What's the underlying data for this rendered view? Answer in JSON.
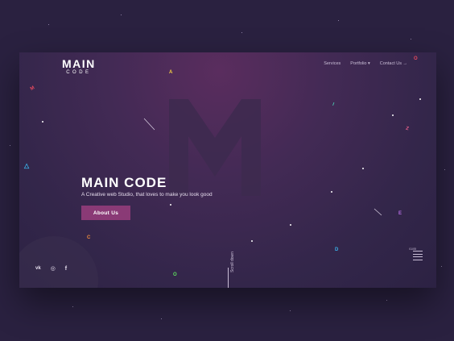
{
  "logo": {
    "line1": "MAIN",
    "line2": "CODE"
  },
  "nav": {
    "items": [
      {
        "label": "Services"
      },
      {
        "label": "Portfolio ▾"
      },
      {
        "label": "Contact Us →"
      }
    ]
  },
  "hero": {
    "title": "MAIN CODE",
    "subtitle": "A Creative web Studio, that loves to make you look good",
    "button_label": "About Us"
  },
  "social": [
    {
      "icon": "vk-icon",
      "glyph": "vk"
    },
    {
      "icon": "dribbble-icon",
      "glyph": "◎"
    },
    {
      "icon": "facebook-icon",
      "glyph": "f"
    }
  ],
  "scroll": {
    "label": "Scroll down"
  },
  "page_indicator": {
    "label": "01/05"
  },
  "floating_letters": [
    {
      "char": "A",
      "color": "#f5d142"
    },
    {
      "char": "M",
      "color": "#e84a5f"
    },
    {
      "char": "O",
      "color": "#e84a5f"
    },
    {
      "char": "I",
      "color": "#4ac9b0"
    },
    {
      "char": "Z",
      "color": "#e8608c"
    },
    {
      "char": "E",
      "color": "#b36be0"
    },
    {
      "char": "C",
      "color": "#f08a3c"
    },
    {
      "char": "D",
      "color": "#3ab0e8"
    },
    {
      "char": "O",
      "color": "#5de05d"
    },
    {
      "char": "△",
      "color": "#3ab0e8"
    }
  ],
  "colors": {
    "background": "#2a2140",
    "accent": "#8a3a76"
  }
}
